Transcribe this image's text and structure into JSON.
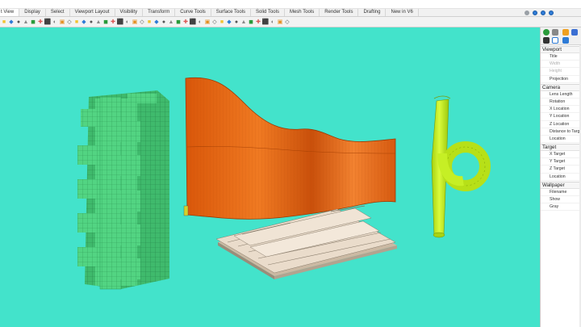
{
  "tabs": [
    "t View",
    "Display",
    "Select",
    "Viewport Layout",
    "Visibility",
    "Transform",
    "Curve Tools",
    "Surface Tools",
    "Solid Tools",
    "Mesh Tools",
    "Render Tools",
    "Drafting",
    "New in V6"
  ],
  "active_tab": "t View",
  "toolbar_icons": [
    "new-icon",
    "open-icon",
    "save-icon",
    "print-icon",
    "undo-icon",
    "pan-icon",
    "zoom-icon",
    "zoom-extents-icon",
    "zoom-window-icon",
    "rotate-view-icon",
    "grid-icon",
    "layer-icon",
    "properties-icon",
    "line-icon",
    "polyline-icon",
    "curve-icon",
    "circle-icon",
    "arc-icon",
    "rectangle-icon",
    "polygon-icon",
    "point-icon",
    "sphere-icon",
    "box-icon",
    "cylinder-icon",
    "shaded-icon",
    "render-icon",
    "material-icon",
    "light-icon",
    "surface-icon",
    "loft-icon",
    "extrude-icon",
    "fillet-icon",
    "trim-icon",
    "split-icon",
    "join-icon",
    "explode-icon",
    "osnap-icon",
    "ortho-icon",
    "gumball-icon",
    "history-icon"
  ],
  "colors": {
    "viewport_bg": "#43e3cb",
    "green_object": "#4fd17d",
    "orange_object": "#e8660f",
    "yellow_object": "#c8f221",
    "beige_object": "#e6d6c2",
    "accent_blue": "#2e7bd6"
  },
  "panel": {
    "viewport": {
      "header": "Viewport",
      "rows": [
        "Title",
        "Width",
        "Height",
        "Projection"
      ]
    },
    "camera": {
      "header": "Camera",
      "rows": [
        "Lens Length",
        "Rotation",
        "X Location",
        "Y Location",
        "Z Location",
        "Distance to Targ",
        "Location"
      ]
    },
    "target": {
      "header": "Target",
      "rows": [
        "X Target",
        "Y Target",
        "Z Target",
        "Location"
      ]
    },
    "wallpaper": {
      "header": "Wallpaper",
      "rows": [
        "Filename",
        "Show",
        "Gray"
      ]
    }
  }
}
